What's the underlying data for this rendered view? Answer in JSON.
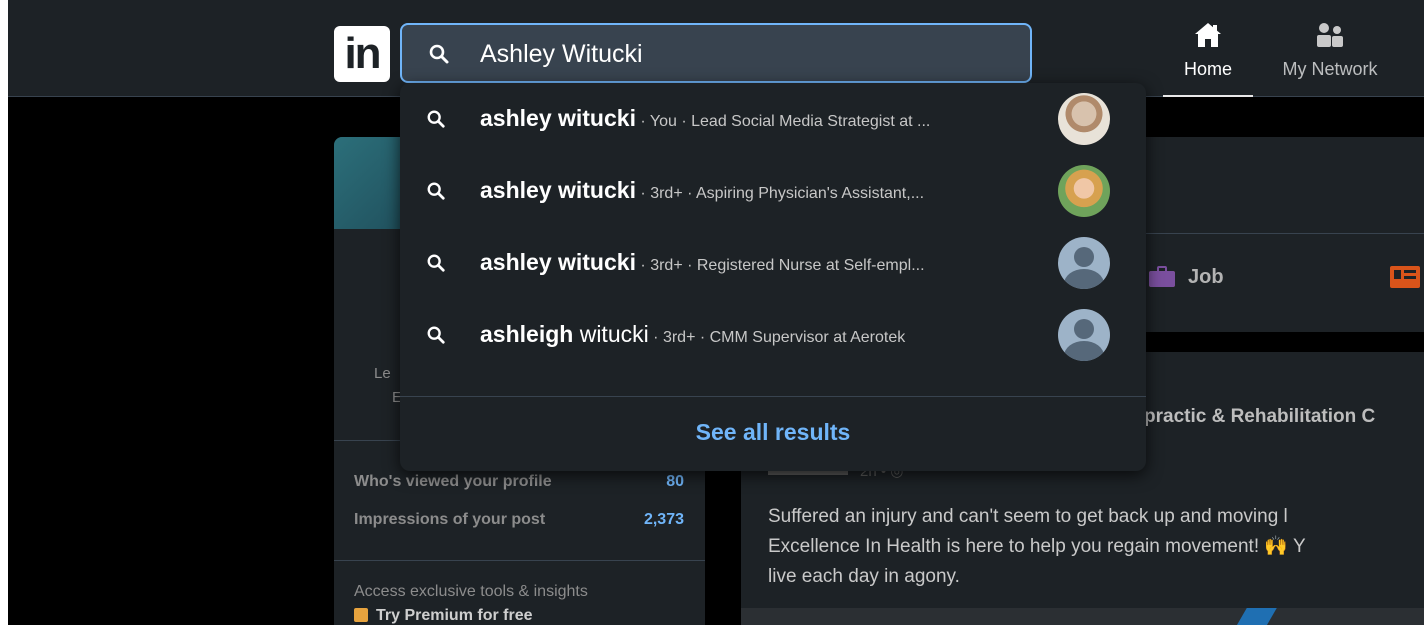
{
  "topnav": {
    "logo_text": "in",
    "search": {
      "value": "Ashley Witucki"
    },
    "nav": [
      {
        "label": "Home",
        "icon": "home-icon",
        "active": true
      },
      {
        "label": "My Network",
        "icon": "network-icon"
      }
    ]
  },
  "dropdown": {
    "suggestions": [
      {
        "name_bold": "ashley witucki",
        "name_rest": "",
        "meta": " · You · Lead Social Media Strategist at ...",
        "avatar": "photo"
      },
      {
        "name_bold": "ashley witucki",
        "name_rest": "",
        "meta": " · 3rd+ · Aspiring Physician's Assistant,...",
        "avatar": "photo"
      },
      {
        "name_bold": "ashley witucki",
        "name_rest": "",
        "meta": " · 3rd+ · Registered Nurse at Self-empl...",
        "avatar": "default"
      },
      {
        "name_bold": "ashleigh",
        "name_rest": " witucki",
        "meta": " · 3rd+ · CMM Supervisor at Aerotek",
        "avatar": "default"
      }
    ],
    "see_all": "See all results"
  },
  "sidebar": {
    "frag1": "Le",
    "frag2": "E",
    "stats": [
      {
        "label": "Who's viewed your profile",
        "value": "80"
      },
      {
        "label": "Impressions of your post",
        "value": "2,373"
      }
    ],
    "premium_text": "Access exclusive tools & insights",
    "premium_link": "Try Premium for free"
  },
  "share": {
    "job_label": "Job"
  },
  "feed": {
    "title_fragment": "practic & Rehabilitation C",
    "meta": "2h • ",
    "lines": [
      "Suffered an injury and can't seem to get back up and moving l",
      "Excellence In Health is here to help you regain movement! 🙌 Y",
      "live each day in agony."
    ]
  },
  "colors": {
    "accent": "#70b5f9",
    "nav_bg": "#1d2226",
    "search_bg": "#38434f"
  }
}
